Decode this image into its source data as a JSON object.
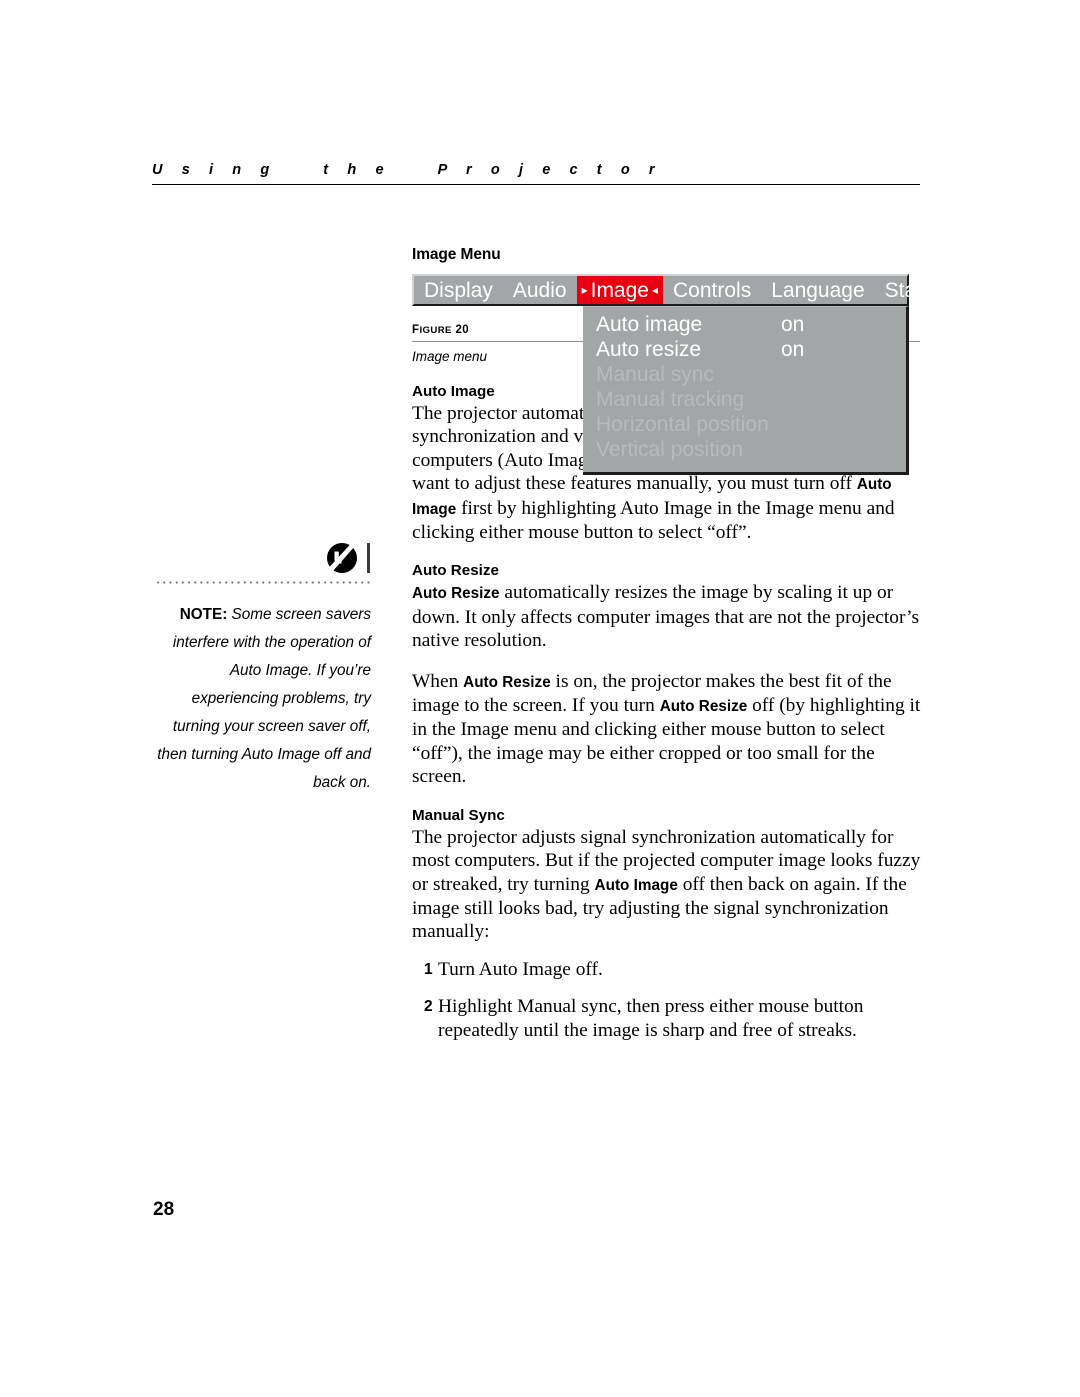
{
  "running_head": "U s i n g    t h e    P r o j e c t o r",
  "page_number": "28",
  "section": {
    "title": "Image Menu"
  },
  "osd": {
    "tabs": [
      {
        "label": "Display",
        "selected": false
      },
      {
        "label": "Audio",
        "selected": false
      },
      {
        "label": "Image",
        "selected": true
      },
      {
        "label": "Controls",
        "selected": false
      },
      {
        "label": "Language",
        "selected": false
      },
      {
        "label": "Status",
        "selected": false
      }
    ],
    "selected_arrow_left": "▸",
    "selected_arrow_right": "◂",
    "items": [
      {
        "label": "Auto image",
        "value": "on",
        "enabled": true
      },
      {
        "label": "Auto resize",
        "value": "on",
        "enabled": true
      },
      {
        "label": "Manual sync",
        "value": "",
        "enabled": false
      },
      {
        "label": "Manual tracking",
        "value": "",
        "enabled": false
      },
      {
        "label": "Horizontal position",
        "value": "",
        "enabled": false
      },
      {
        "label": "Vertical position",
        "value": "",
        "enabled": false
      }
    ],
    "colors": {
      "panel_gray": "#a2a6a7",
      "selected_red": "#e60012",
      "enabled_text": "#ffffff",
      "disabled_text": "#b8bbbc"
    }
  },
  "figure": {
    "label_first": "F",
    "label_rest": "IGURE",
    "label_number": "20",
    "caption": "Image menu"
  },
  "note": {
    "prefix": "NOTE:",
    "body": " Some screen savers interfere with the operation of Auto Image. If you’re experiencing problems, try turning your screen saver off, then turning Auto Image off and back on."
  },
  "sections": {
    "auto_image": {
      "heading": "Auto Image",
      "para_1a": "The projector automatically adjusts tracking, signal synchronization and vertical and horizontal position for most computers (Auto Image does not apply to video sources). If you want to adjust these features manually, you must turn off ",
      "para_1_bold": "Auto Image",
      "para_1b": " first by highlighting Auto Image in the Image menu and clicking either mouse button to select “off”."
    },
    "auto_resize": {
      "heading": "Auto Resize",
      "para_1_bold": "Auto Resize",
      "para_1a": " automatically resizes the image by scaling it up or down. It only affects computer images that are not the projector’s native resolution.",
      "para_2a": "When ",
      "para_2_bold_1": "Auto Resize",
      "para_2b": " is on, the projector makes the best fit of the image to the screen. If you turn ",
      "para_2_bold_2": "Auto Resize",
      "para_2c": " off (by highlighting it in the Image menu and clicking either mouse button to select “off”), the image may be either cropped or too small for the screen."
    },
    "manual_sync": {
      "heading": "Manual Sync",
      "para_1a": "The projector adjusts signal synchronization automatically for most computers. But if the projected computer image looks fuzzy or streaked, try turning ",
      "para_1_bold": "Auto Image",
      "para_1b": " off then back on again. If the image still looks bad, try adjusting the signal synchronization manually:",
      "steps": [
        {
          "num": "1",
          "text": "Turn Auto Image off."
        },
        {
          "num": "2",
          "text": "Highlight Manual sync, then press either mouse button repeatedly until the image is sharp and free of streaks."
        }
      ]
    }
  }
}
